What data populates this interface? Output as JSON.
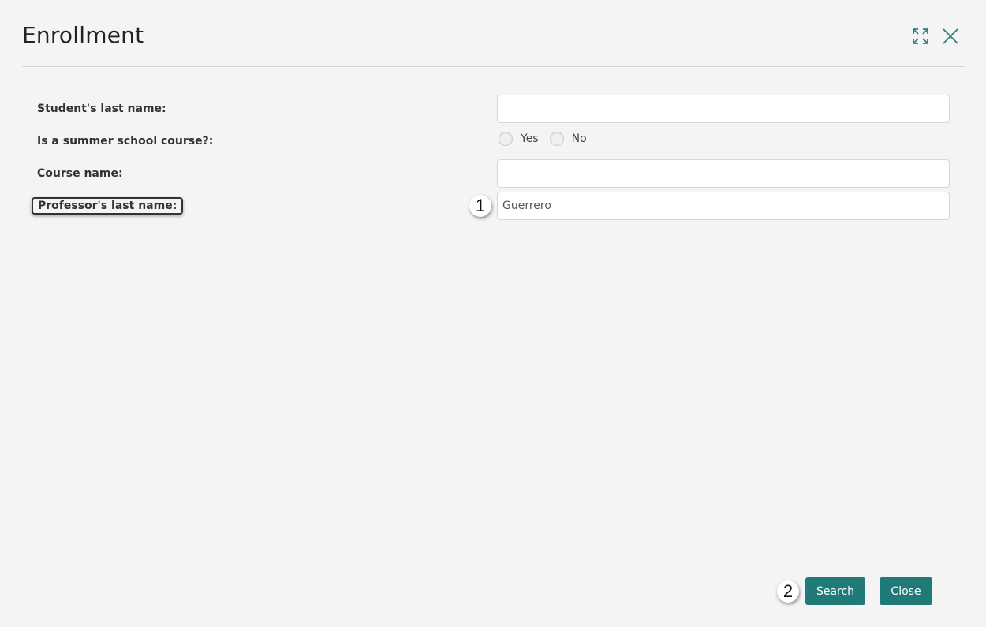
{
  "dialog": {
    "title": "Enrollment",
    "icons": {
      "expand": "expand-icon",
      "close": "close-icon"
    },
    "accent_color": "#1f7a78"
  },
  "form": {
    "student_last_name": {
      "label": "Student's last name:",
      "value": ""
    },
    "summer_school": {
      "label": "Is a summer school course?:",
      "options": [
        "Yes",
        "No"
      ],
      "selected": null
    },
    "course_name": {
      "label": "Course name:",
      "value": ""
    },
    "professor_last_name": {
      "label": "Professor's last name:",
      "value": "Guerrero"
    }
  },
  "annotations": {
    "badge_1": "1",
    "badge_2": "2"
  },
  "footer": {
    "search_label": "Search",
    "close_label": "Close"
  }
}
